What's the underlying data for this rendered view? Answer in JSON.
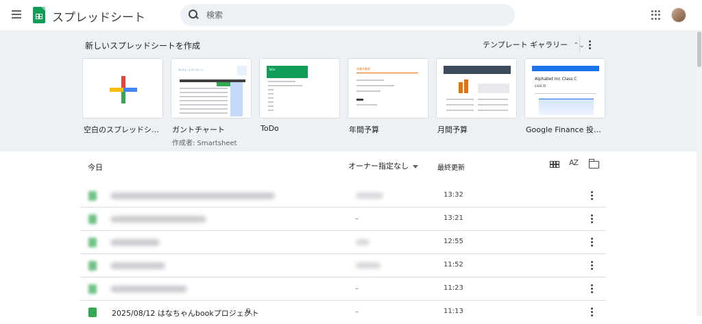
{
  "app": {
    "title": "スプレッドシート",
    "logo_icon": "sheets-logo-icon"
  },
  "search": {
    "placeholder": "検索"
  },
  "templates": {
    "heading": "新しいスプレッドシートを作成",
    "gallery_label": "テンプレート ギャラリー",
    "gallery_chevron": "⌃⌄",
    "items": [
      {
        "name": "空白のスプレッドシート",
        "sub": ""
      },
      {
        "name": "ガントチャート",
        "sub": "作成者: Smartsheet"
      },
      {
        "name": "ToDo",
        "sub": ""
      },
      {
        "name": "年間予算",
        "sub": ""
      },
      {
        "name": "月間予算",
        "sub": ""
      },
      {
        "name": "Google Finance 投資ト…",
        "sub": ""
      }
    ],
    "thumb_text": {
      "finance_title": "Alphabet Inc Class C",
      "finance_price": "£420.55",
      "gantt_title": "ガンチャート テンプレート",
      "todo_title": "ToDo",
      "annual_title": "年間予算表"
    }
  },
  "list": {
    "section_label": "今日",
    "owner_filter": "オーナー指定なし",
    "modified_label": "最終更新",
    "sort_icon_label": "AZ",
    "rows": [
      {
        "name": "",
        "owner": "",
        "time": "13:32",
        "blurred": true
      },
      {
        "name": "",
        "owner": "–",
        "time": "13:21",
        "blurred": true
      },
      {
        "name": "",
        "owner": "",
        "time": "12:55",
        "blurred": true
      },
      {
        "name": "",
        "owner": "",
        "time": "11:52",
        "blurred": true
      },
      {
        "name": "",
        "owner": "–",
        "time": "11:23",
        "blurred": true
      },
      {
        "name": "2025/08/12 はなちゃんbookプロジェクト",
        "owner": "–",
        "time": "11:13",
        "blurred": false
      }
    ]
  },
  "colors": {
    "sheets_green": "#0f9d58",
    "template_bg": "#eef1f4",
    "search_bg": "#eef2f7"
  }
}
